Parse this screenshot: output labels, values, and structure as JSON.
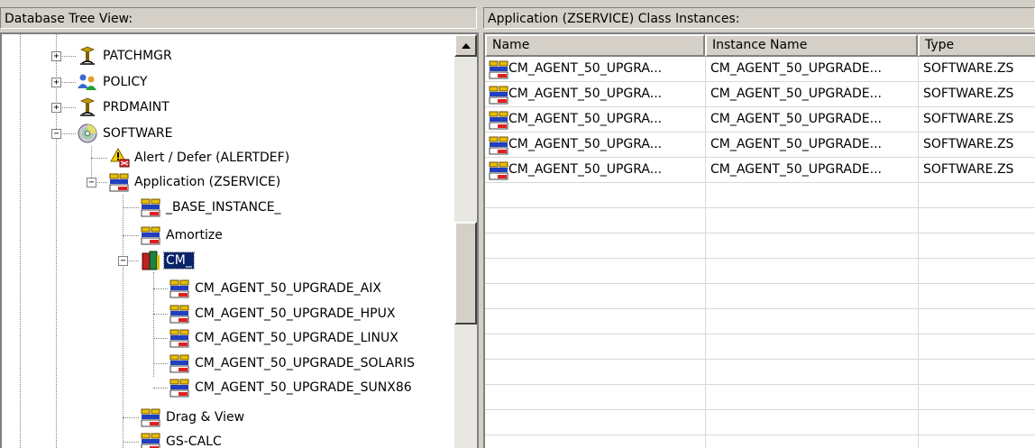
{
  "left_pane": {
    "title": "Database Tree View:",
    "tree": [
      {
        "label": "PATCHMGR",
        "icon": "domain-icon"
      },
      {
        "label": "POLICY",
        "icon": "policy-users-icon"
      },
      {
        "label": "PRDMAINT",
        "icon": "domain-icon"
      },
      {
        "label": "SOFTWARE",
        "icon": "software-cd-icon"
      },
      {
        "label": "Alert / Defer (ALERTDEF)",
        "icon": "alert-class-icon"
      },
      {
        "label": "Application (ZSERVICE)",
        "icon": "application-class-icon"
      },
      {
        "label": "_BASE_INSTANCE_",
        "icon": "application-instance-icon"
      },
      {
        "label": "Amortize",
        "icon": "application-instance-icon"
      },
      {
        "label": "CM_",
        "icon": "book-folder-icon"
      },
      {
        "label": "CM_AGENT_50_UPGRADE_AIX",
        "icon": "application-instance-icon"
      },
      {
        "label": "CM_AGENT_50_UPGRADE_HPUX",
        "icon": "application-instance-icon"
      },
      {
        "label": "CM_AGENT_50_UPGRADE_LINUX",
        "icon": "application-instance-icon"
      },
      {
        "label": "CM_AGENT_50_UPGRADE_SOLARIS",
        "icon": "application-instance-icon"
      },
      {
        "label": "CM_AGENT_50_UPGRADE_SUNX86",
        "icon": "application-instance-icon"
      },
      {
        "label": "Drag & View",
        "icon": "application-instance-icon"
      },
      {
        "label": "GS-CALC",
        "icon": "application-instance-icon"
      }
    ],
    "expanders": {
      "collapsed": "+",
      "expanded": "−"
    }
  },
  "right_pane": {
    "title": "Application (ZSERVICE) Class Instances:",
    "columns": [
      "Name",
      "Instance Name",
      "Type"
    ],
    "rows": [
      [
        "CM_AGENT_50_UPGRA...",
        "CM_AGENT_50_UPGRADE...",
        "SOFTWARE.ZS"
      ],
      [
        "CM_AGENT_50_UPGRA...",
        "CM_AGENT_50_UPGRADE...",
        "SOFTWARE.ZS"
      ],
      [
        "CM_AGENT_50_UPGRA...",
        "CM_AGENT_50_UPGRADE...",
        "SOFTWARE.ZS"
      ],
      [
        "CM_AGENT_50_UPGRA...",
        "CM_AGENT_50_UPGRADE...",
        "SOFTWARE.ZS"
      ],
      [
        "CM_AGENT_50_UPGRA...",
        "CM_AGENT_50_UPGRADE...",
        "SOFTWARE.ZS"
      ]
    ]
  },
  "colors": {
    "selection": "#0a246a",
    "chrome": "#d4d0c8",
    "tree_lines": "#808080"
  }
}
